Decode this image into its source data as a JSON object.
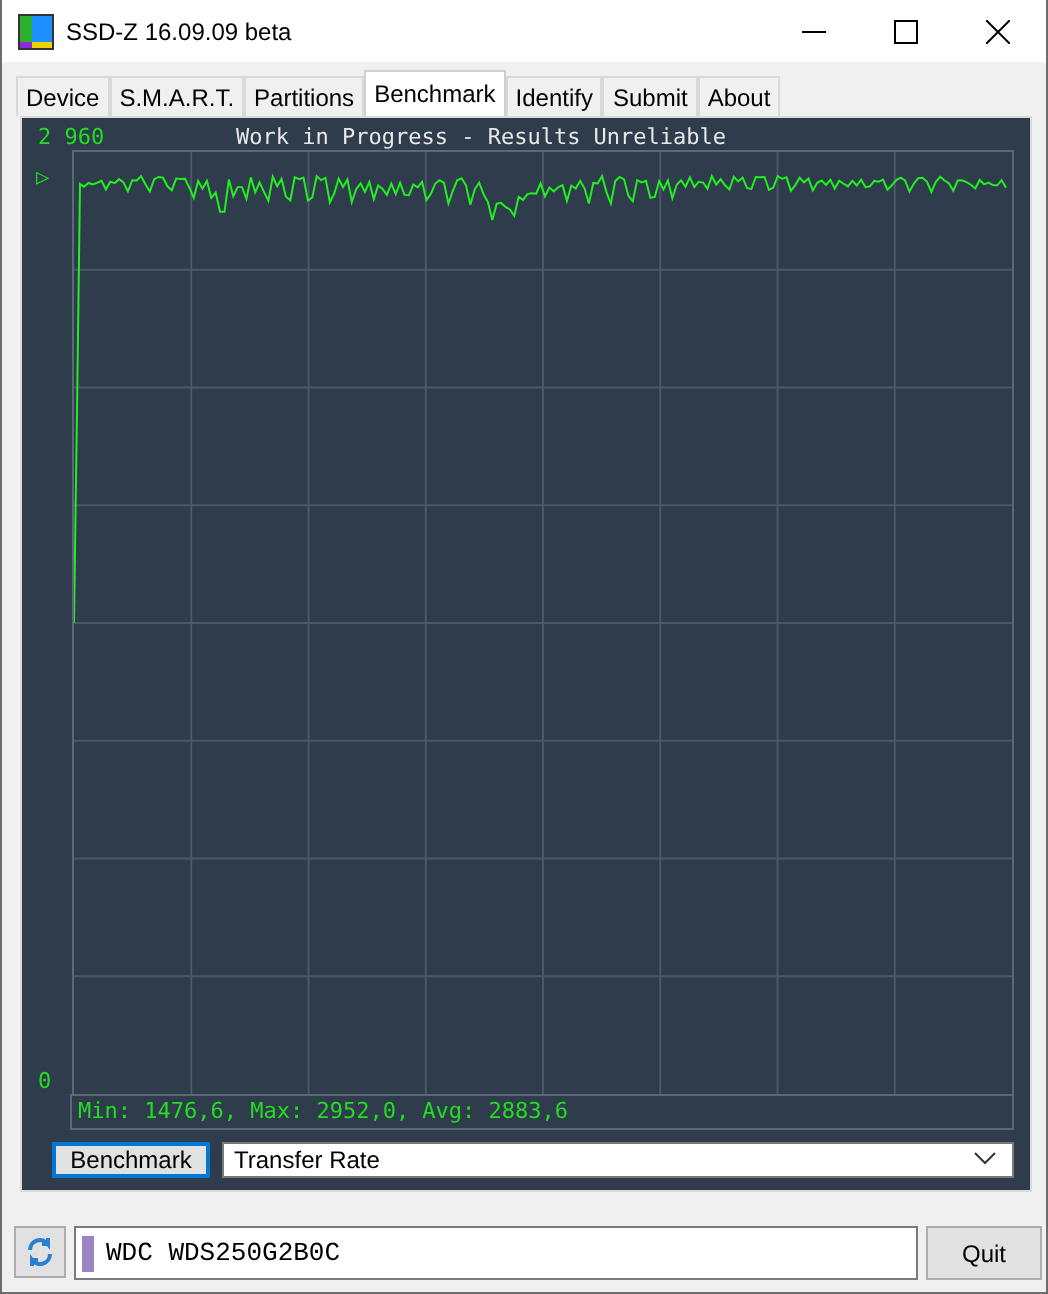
{
  "window": {
    "title": "SSD-Z 16.09.09 beta"
  },
  "tabs": [
    {
      "label": "Device",
      "selected": false
    },
    {
      "label": "S.M.A.R.T.",
      "selected": false
    },
    {
      "label": "Partitions",
      "selected": false
    },
    {
      "label": "Benchmark",
      "selected": true
    },
    {
      "label": "Identify",
      "selected": false
    },
    {
      "label": "Submit",
      "selected": false
    },
    {
      "label": "About",
      "selected": false
    }
  ],
  "graph": {
    "y_max_label": "2 960",
    "y_min_label": "0",
    "marker": "▷",
    "title": "Work in Progress - Results Unreliable",
    "stats": "Min: 1476,6, Max: 2952,0, Avg: 2883,6"
  },
  "controls": {
    "button": "Benchmark",
    "mode": "Transfer Rate"
  },
  "status_bar": {
    "drive": "WDC WDS250G2B0C",
    "quit": "Quit"
  }
}
